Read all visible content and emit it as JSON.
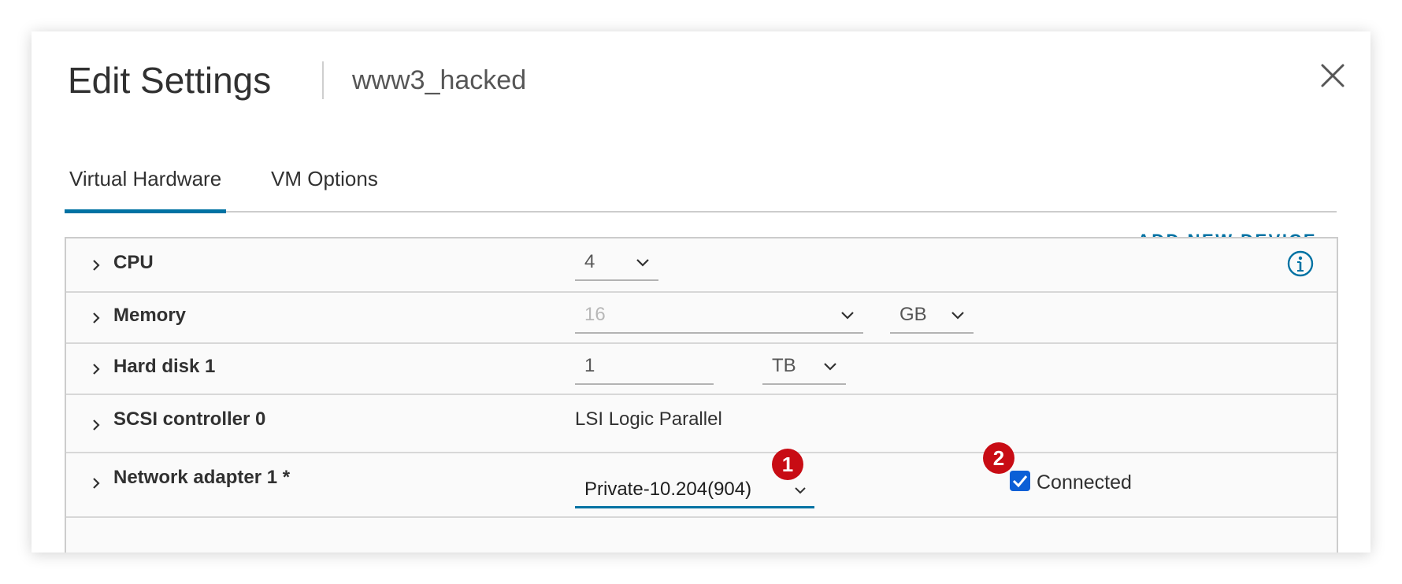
{
  "dialog": {
    "title": "Edit Settings",
    "subtitle": "www3_hacked",
    "close_icon": "close-icon"
  },
  "tabs": [
    {
      "label": "Virtual Hardware",
      "active": true
    },
    {
      "label": "VM Options",
      "active": false
    }
  ],
  "add_new_device": {
    "label": "ADD NEW DEVICE",
    "icon": "chevron-down-icon"
  },
  "colors": {
    "accent": "#0072a3",
    "badge": "#c80c14",
    "checkbox": "#0b5fd6"
  },
  "rows": {
    "cpu": {
      "label": "CPU",
      "value": "4",
      "info_icon": "info-icon"
    },
    "memory": {
      "label": "Memory",
      "value": "16",
      "unit": "GB"
    },
    "hard_disk": {
      "label": "Hard disk 1",
      "value": "1",
      "unit": "TB"
    },
    "scsi": {
      "label": "SCSI controller 0",
      "value": "LSI Logic Parallel"
    },
    "network": {
      "label": "Network adapter 1 *",
      "value": "Private-10.204(904)",
      "connected_label": "Connected",
      "connected_checked": true
    }
  },
  "annotations": {
    "badge_1": "1",
    "badge_2": "2"
  }
}
